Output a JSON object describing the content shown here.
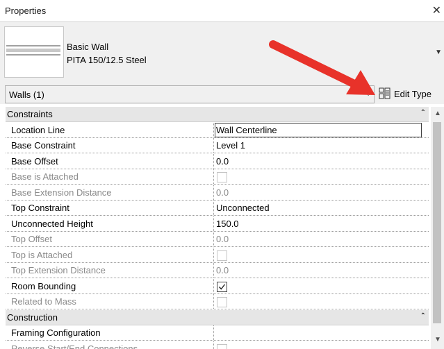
{
  "panel": {
    "title": "Properties",
    "close_glyph": "✕"
  },
  "type_selector": {
    "family": "Basic Wall",
    "type": "PITA 150/12.5 Steel",
    "dropdown_glyph": "▼"
  },
  "filter": {
    "label": "Walls (1)",
    "chevron": "⌄"
  },
  "edit_type": {
    "label": "Edit Type",
    "icon": "edit-type-icon"
  },
  "annotation": {
    "arrow_color": "#e8322a"
  },
  "groups": [
    {
      "label": "Constraints",
      "collapse_glyph": "⌃",
      "rows": [
        {
          "name": "Location Line",
          "value": "Wall Centerline",
          "kind": "text",
          "disabled": false,
          "editing": true
        },
        {
          "name": "Base Constraint",
          "value": "Level 1",
          "kind": "text",
          "disabled": false
        },
        {
          "name": "Base Offset",
          "value": "0.0",
          "kind": "text",
          "disabled": false
        },
        {
          "name": "Base is Attached",
          "value": "",
          "kind": "checkbox",
          "checked": false,
          "disabled": true
        },
        {
          "name": "Base Extension Distance",
          "value": "0.0",
          "kind": "text",
          "disabled": true
        },
        {
          "name": "Top Constraint",
          "value": "Unconnected",
          "kind": "text",
          "disabled": false
        },
        {
          "name": "Unconnected Height",
          "value": "150.0",
          "kind": "text",
          "disabled": false
        },
        {
          "name": "Top Offset",
          "value": "0.0",
          "kind": "text",
          "disabled": true
        },
        {
          "name": "Top is Attached",
          "value": "",
          "kind": "checkbox",
          "checked": false,
          "disabled": true
        },
        {
          "name": "Top Extension Distance",
          "value": "0.0",
          "kind": "text",
          "disabled": true
        },
        {
          "name": "Room Bounding",
          "value": "",
          "kind": "checkbox",
          "checked": true,
          "disabled": false
        },
        {
          "name": "Related to Mass",
          "value": "",
          "kind": "checkbox",
          "checked": false,
          "disabled": true
        }
      ]
    },
    {
      "label": "Construction",
      "collapse_glyph": "⌃",
      "rows": [
        {
          "name": "Framing Configuration",
          "value": "",
          "kind": "text",
          "disabled": false
        },
        {
          "name": "Reverse Start/End Connections",
          "value": "",
          "kind": "checkbox",
          "checked": false,
          "disabled": true
        }
      ]
    }
  ],
  "scrollbar": {
    "up_glyph": "▲",
    "down_glyph": "▼"
  }
}
